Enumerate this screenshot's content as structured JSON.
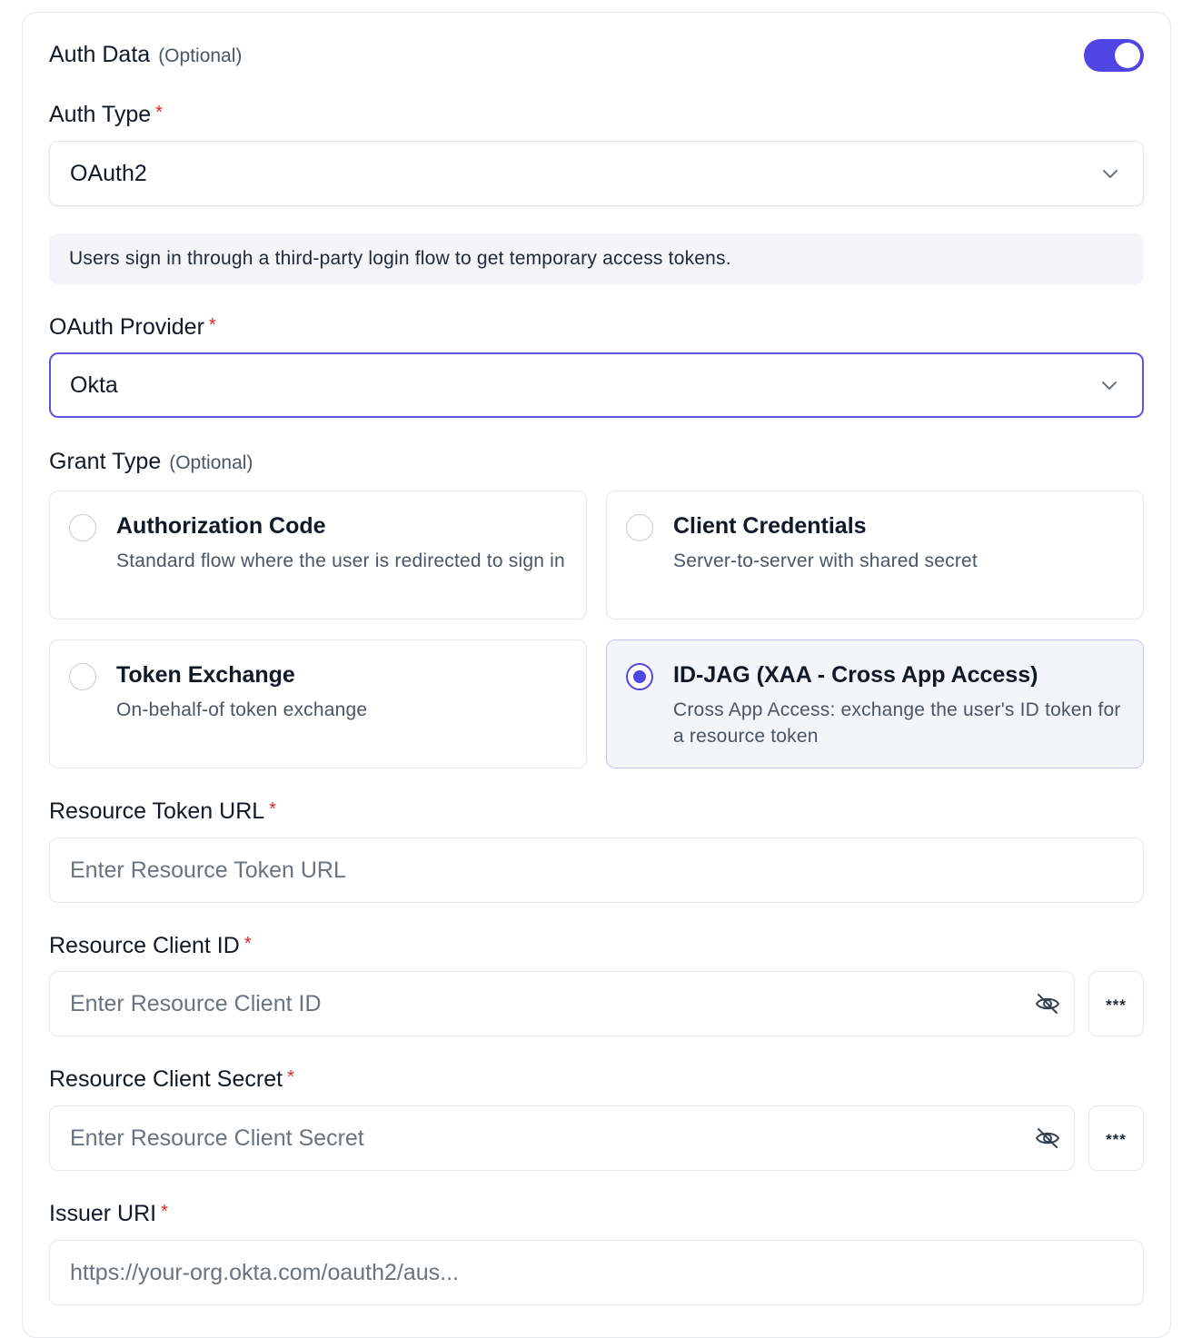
{
  "auth_data": {
    "label": "Auth Data",
    "optional_text": "(Optional)",
    "enabled": true
  },
  "auth_type": {
    "label": "Auth Type",
    "required_mark": "*",
    "value": "OAuth2",
    "info": "Users sign in through a third-party login flow to get temporary access tokens."
  },
  "oauth_provider": {
    "label": "OAuth Provider",
    "required_mark": "*",
    "value": "Okta"
  },
  "grant_type": {
    "label": "Grant Type",
    "optional_text": "(Optional)",
    "options": [
      {
        "title": "Authorization Code",
        "description": "Standard flow where the user is redirected to sign in",
        "selected": false
      },
      {
        "title": "Client Credentials",
        "description": "Server-to-server with shared secret",
        "selected": false
      },
      {
        "title": "Token Exchange",
        "description": "On-behalf-of token exchange",
        "selected": false
      },
      {
        "title": "ID-JAG (XAA - Cross App Access)",
        "description": "Cross App Access: exchange the user's ID token for a resource token",
        "selected": true
      }
    ]
  },
  "resource_token_url": {
    "label": "Resource Token URL",
    "required_mark": "*",
    "value": "",
    "placeholder": "Enter Resource Token URL"
  },
  "resource_client_id": {
    "label": "Resource Client ID",
    "required_mark": "*",
    "value": "",
    "placeholder": "Enter Resource Client ID",
    "secret_button": "***"
  },
  "resource_client_secret": {
    "label": "Resource Client Secret",
    "required_mark": "*",
    "value": "",
    "placeholder": "Enter Resource Client Secret",
    "secret_button": "***"
  },
  "issuer_uri": {
    "label": "Issuer URI",
    "required_mark": "*",
    "value": "",
    "placeholder": "https://your-org.okta.com/oauth2/aus..."
  },
  "colors": {
    "accent": "#5046e5",
    "required": "#dc2626",
    "info_bg": "#f4f4f9"
  },
  "icons": {
    "select_chevron": "chevron-down-icon",
    "visibility": "eye-off-icon"
  }
}
